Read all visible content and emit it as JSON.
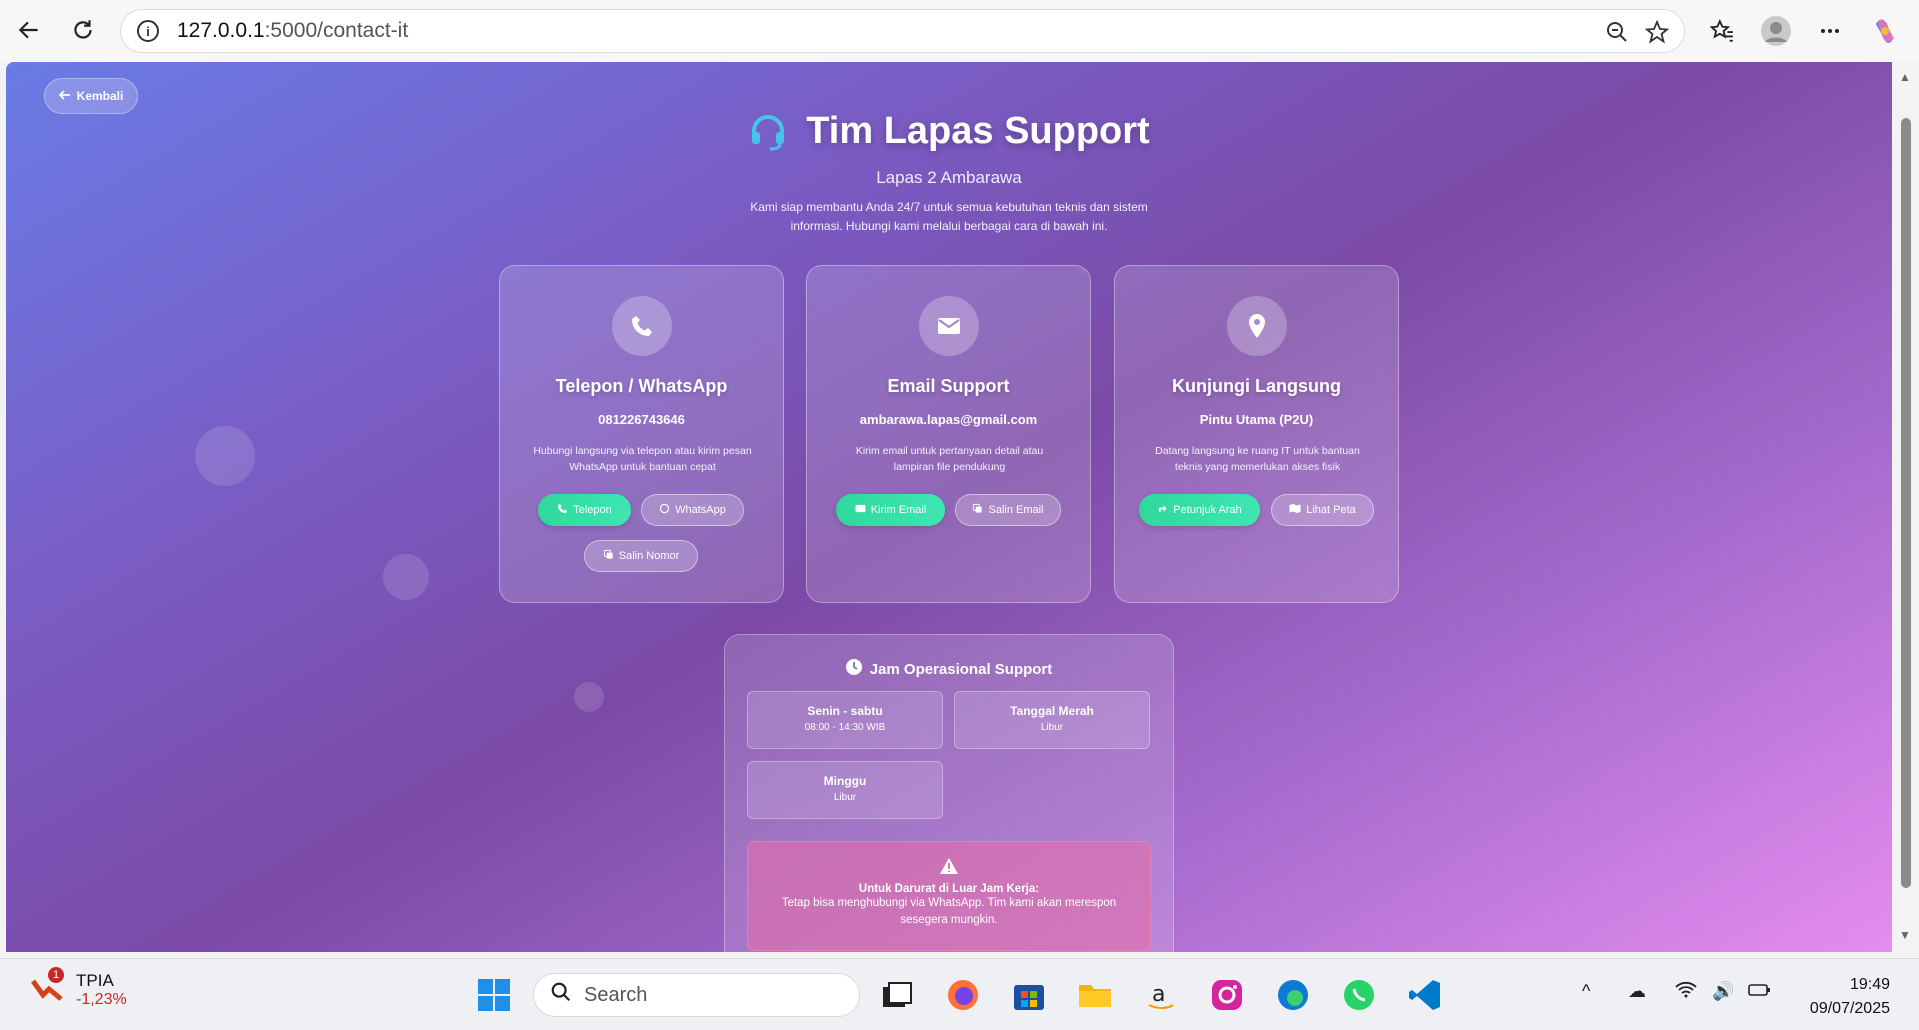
{
  "browser": {
    "url_host": "127.0.0.1",
    "url_path": ":5000/contact-it"
  },
  "page": {
    "back_label": "Kembali",
    "title": "Tim Lapas Support",
    "subtitle": "Lapas 2 Ambarawa",
    "description": "Kami siap membantu Anda 24/7 untuk semua kebutuhan teknis dan sistem informasi. Hubungi kami melalui berbagai cara di bawah ini."
  },
  "cards": [
    {
      "title": "Telepon / WhatsApp",
      "value": "081226743646",
      "desc": "Hubungi langsung via telepon atau kirim pesan WhatsApp untuk bantuan cepat",
      "buttons": [
        "Telepon",
        "WhatsApp",
        "Salin Nomor"
      ]
    },
    {
      "title": "Email Support",
      "value": "ambarawa.lapas@gmail.com",
      "desc": "Kirim email untuk pertanyaan detail atau lampiran file pendukung",
      "buttons": [
        "Kirim Email",
        "Salin Email"
      ]
    },
    {
      "title": "Kunjungi Langsung",
      "value": "Pintu Utama (P2U)",
      "desc": "Datang langsung ke ruang IT untuk bantuan teknis yang memerlukan akses fisik",
      "buttons": [
        "Petunjuk Arah",
        "Lihat Peta"
      ]
    }
  ],
  "hours": {
    "title": "Jam Operasional Support",
    "rows": [
      {
        "day": "Senin - sabtu",
        "time": "08:00 - 14:30 WIB"
      },
      {
        "day": "Tanggal Merah",
        "time": "Libur"
      },
      {
        "day": "Minggu",
        "time": "Libur"
      }
    ],
    "emergency_title": "Untuk Darurat di Luar Jam Kerja:",
    "emergency_text": "Tetap bisa menghubungi via WhatsApp. Tim kami akan merespon sesegera mungkin."
  },
  "taskbar": {
    "stock_name": "TPIA",
    "stock_change": "-1,23%",
    "stock_badge": "1",
    "search_placeholder": "Search",
    "time": "19:49",
    "date": "09/07/2025"
  }
}
